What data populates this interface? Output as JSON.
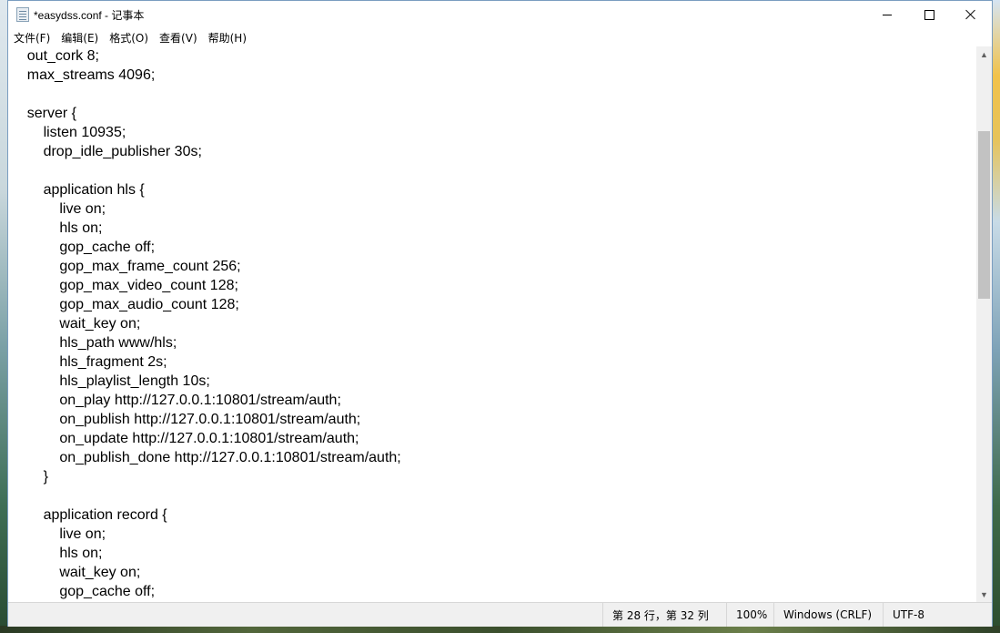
{
  "window": {
    "title": "*easydss.conf - 记事本",
    "min_symbol": "",
    "max_symbol": "",
    "close_symbol": ""
  },
  "menu": {
    "items": [
      {
        "label": "文件(F)"
      },
      {
        "label": "编辑(E)"
      },
      {
        "label": "格式(O)"
      },
      {
        "label": "查看(V)"
      },
      {
        "label": "帮助(H)"
      }
    ]
  },
  "editor": {
    "lines": [
      "    out_cork 8;",
      "    max_streams 4096;",
      "",
      "    server {",
      "        listen 10935;",
      "        drop_idle_publisher 30s;",
      "",
      "        application hls {",
      "            live on;",
      "            hls on;",
      "            gop_cache off;",
      "            gop_max_frame_count 256;",
      "            gop_max_video_count 128;",
      "            gop_max_audio_count 128;",
      "            wait_key on;",
      "            hls_path www/hls;",
      "            hls_fragment 2s;",
      "            hls_playlist_length 10s;",
      "            on_play http://127.0.0.1:10801/stream/auth;",
      "            on_publish http://127.0.0.1:10801/stream/auth;",
      "            on_update http://127.0.0.1:10801/stream/auth;",
      "            on_publish_done http://127.0.0.1:10801/stream/auth;",
      "        }",
      "",
      "        application record {",
      "            live on;",
      "            hls on;",
      "            wait_key on;",
      "            gop_cache off;"
    ]
  },
  "status": {
    "position": "第 28 行，第 32 列",
    "zoom": "100%",
    "line_ending": "Windows (CRLF)",
    "encoding": "UTF-8"
  }
}
